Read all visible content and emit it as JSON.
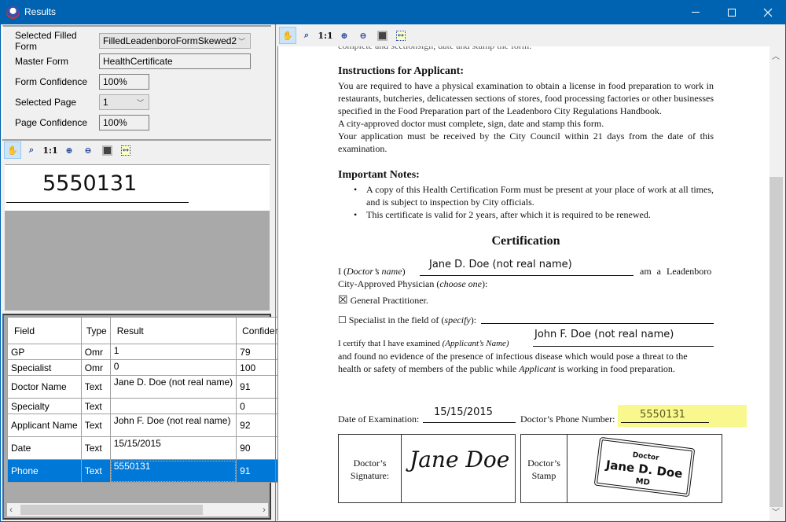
{
  "window": {
    "title": "Results",
    "controls": {
      "minimize": "minimize",
      "maximize": "maximize",
      "close": "close"
    }
  },
  "properties": {
    "selected_filled_form": {
      "label": "Selected Filled Form",
      "value": "FilledLeadenboroFormSkewed2"
    },
    "master_form": {
      "label": "Master Form",
      "value": "HealthCertificate"
    },
    "form_confidence": {
      "label": "Form Confidence",
      "value": "100%"
    },
    "selected_page": {
      "label": "Selected Page",
      "value": "1"
    },
    "page_confidence": {
      "label": "Page Confidence",
      "value": "100%"
    }
  },
  "toolbar": {
    "buttons": [
      {
        "name": "pan",
        "icon": "hand-icon"
      },
      {
        "name": "zoom-rect",
        "icon": "zoom-rect-icon"
      },
      {
        "name": "actual-size",
        "label": "1:1"
      },
      {
        "name": "zoom-in",
        "icon": "zoom-in-icon"
      },
      {
        "name": "zoom-out",
        "icon": "zoom-out-icon"
      },
      {
        "name": "fit-page",
        "icon": "fit-page-icon"
      },
      {
        "name": "fit-width",
        "icon": "fit-width-icon"
      }
    ]
  },
  "field_preview": {
    "text": "5550131"
  },
  "results_grid": {
    "columns": [
      "Field",
      "Type",
      "Result",
      "Confidence"
    ],
    "rows": [
      {
        "field": "GP",
        "type": "Omr",
        "result": "1",
        "confidence": "79"
      },
      {
        "field": "Specialist",
        "type": "Omr",
        "result": "0",
        "confidence": "100"
      },
      {
        "field": "Doctor Name",
        "type": "Text",
        "result": "Jane D. Doe (not real name)",
        "confidence": "91"
      },
      {
        "field": "Specialty",
        "type": "Text",
        "result": "",
        "confidence": "0"
      },
      {
        "field": "Applicant Name",
        "type": "Text",
        "result": "John F. Doe (not real name)",
        "confidence": "92"
      },
      {
        "field": "Date",
        "type": "Text",
        "result": "15/15/2015",
        "confidence": "90"
      },
      {
        "field": "Phone",
        "type": "Text",
        "result": "5550131",
        "confidence": "91",
        "selected": true
      }
    ]
  },
  "document": {
    "instructions_heading": "Instructions for Applicant:",
    "instructions_p1": "You are required to have a physical examination to obtain a license in food preparation to work in restaurants, butcheries, delicatessen sections of stores, food processing factories or other businesses specified in the Food Preparation part of the Leadenboro City Regulations Handbook.",
    "instructions_p2": "A city-approved doctor must complete, sign, date and stamp this form.",
    "instructions_p3": "Your application must be received by the City Council within 21 days from the date of this examination.",
    "notes_heading": "Important Notes:",
    "notes": [
      "A copy of this Health Certification Form must be present at your place of work at all times, and is subject to inspection by City officials.",
      "This certificate is valid for 2 years, after which it is required to be renewed."
    ],
    "certification_title": "Certification",
    "doctor_name_prefix": "I (",
    "doctor_name_label": "Doctor’s name",
    "doctor_name_suffix": ")",
    "doctor_name_value": "Jane D. Doe (not real name)",
    "am_a": "am a Leadenboro",
    "physician_line": "City-Approved Physician (",
    "choose_one": "choose one",
    "physician_line_end": "):",
    "gp_label": "General Practitioner.",
    "gp_checked": true,
    "specialist_label": "☐ Specialist in the field of (",
    "specify": "specify",
    "specialist_end": "):",
    "certify_prefix": "I certify that I have examined ",
    "applicant_label": "(Applicant’s Name)",
    "applicant_value": "John F. Doe (not real name)",
    "certify_p2": "and found no evidence of the presence of infectious disease which would pose a threat to the",
    "certify_p3_a": "health or safety of members of the public while ",
    "certify_p3_italic": "Applicant",
    "certify_p3_b": " is working in food preparation.",
    "date_label": "Date of Examination:",
    "date_value": "15/15/2015",
    "phone_label": "Doctor’s Phone Number:",
    "phone_value": "5550131",
    "signature_label": "Doctor’s Signature:",
    "signature_value": "Jane Doe",
    "stamp_label": "Doctor’s Stamp",
    "stamp_line1": "Doctor",
    "stamp_line2": "Jane D. Doe",
    "stamp_line3": "MD"
  },
  "colors": {
    "titlebar": "#0063b1",
    "selection": "#0078d7",
    "highlight": "#f7f77a"
  }
}
